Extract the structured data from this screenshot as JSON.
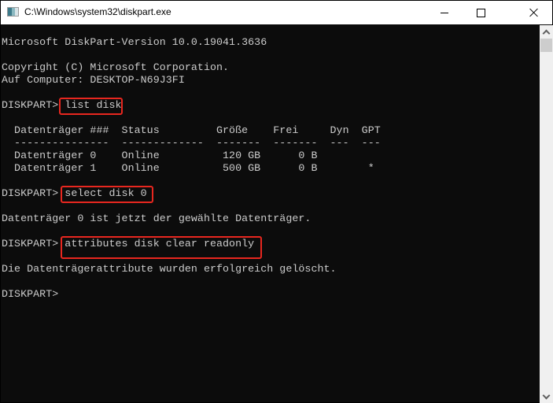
{
  "window": {
    "title": "C:\\Windows\\system32\\diskpart.exe",
    "icon": "console-app-icon",
    "controls": {
      "minimize": "minimize-icon",
      "maximize": "maximize-icon",
      "close": "close-icon"
    }
  },
  "console": {
    "lines": [
      "Microsoft DiskPart-Version 10.0.19041.3636",
      "",
      "Copyright (C) Microsoft Corporation.",
      "Auf Computer: DESKTOP-N69J3FI",
      "",
      "DISKPART> list disk",
      "",
      "  Datenträger ###  Status         Größe    Frei     Dyn  GPT",
      "  ---------------  -------------  -------  -------  ---  ---",
      "  Datenträger 0    Online          120 GB      0 B",
      "  Datenträger 1    Online          500 GB      0 B        *",
      "",
      "DISKPART> select disk 0",
      "",
      "Datenträger 0 ist jetzt der gewählte Datenträger.",
      "",
      "DISKPART> attributes disk clear readonly",
      "",
      "Die Datenträgerattribute wurden erfolgreich gelöscht.",
      "",
      "DISKPART> "
    ],
    "prompt": "DISKPART>",
    "highlighted_commands": [
      "list disk",
      "select disk 0",
      "attributes disk clear readonly"
    ],
    "disk_table": {
      "columns": [
        "Datenträger ###",
        "Status",
        "Größe",
        "Frei",
        "Dyn",
        "GPT"
      ],
      "rows": [
        [
          "Datenträger 0",
          "Online",
          "120 GB",
          "0 B",
          "",
          ""
        ],
        [
          "Datenträger 1",
          "Online",
          "500 GB",
          "0 B",
          "",
          "*"
        ]
      ]
    }
  },
  "colors": {
    "console_bg": "#0c0c0c",
    "console_text": "#cccccc",
    "highlight_box": "#e8271f"
  }
}
